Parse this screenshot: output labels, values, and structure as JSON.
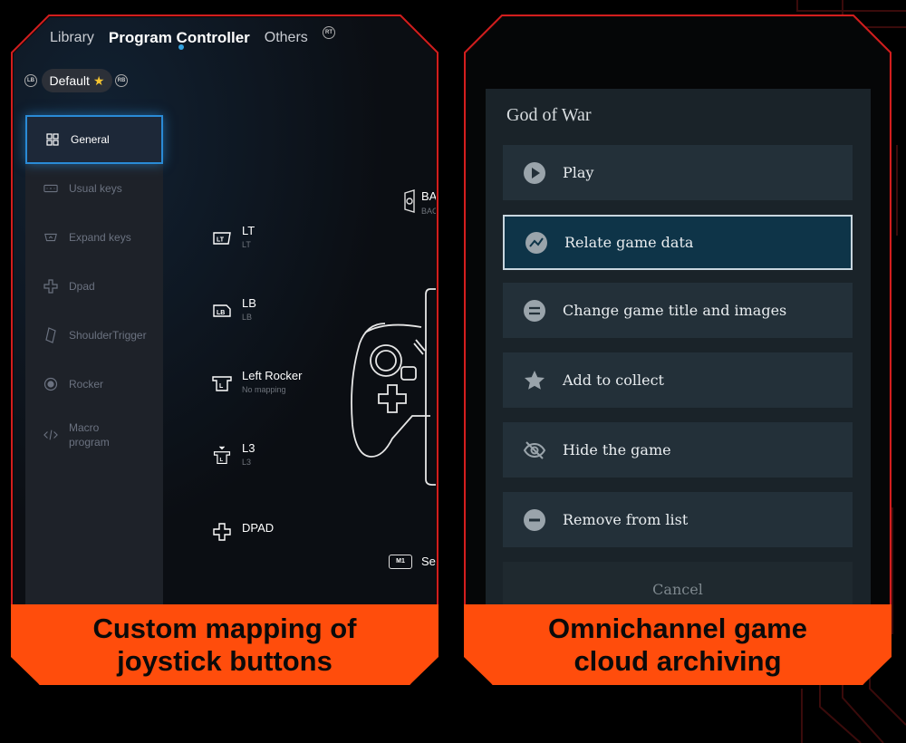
{
  "colors": {
    "accent_orange": "#ff4d0c",
    "frame_red": "#d21e1e",
    "active_blue": "#2a8bd6"
  },
  "left_panel": {
    "tabs": [
      "Library",
      "Program Controller",
      "Others"
    ],
    "rt_hint": "RT",
    "lb_hint": "LB",
    "rb_hint": "RB",
    "profile": "Default",
    "sidebar": [
      {
        "label": "General",
        "icon": "grid-icon",
        "active": true
      },
      {
        "label": "Usual keys",
        "icon": "keyboard-icon"
      },
      {
        "label": "Expand keys",
        "icon": "expand-key-icon"
      },
      {
        "label": "Dpad",
        "icon": "dpad-icon"
      },
      {
        "label": "ShoulderTrigger",
        "icon": "shoulder-trigger-icon"
      },
      {
        "label": "Rocker",
        "icon": "rocker-icon"
      },
      {
        "label": "Macro program",
        "line1": "Macro",
        "line2": "program",
        "icon": "code-icon"
      }
    ],
    "mappings": [
      {
        "title": "LT",
        "sub": "LT",
        "icon": "lt-icon"
      },
      {
        "title": "LB",
        "sub": "LB",
        "icon": "lb-icon"
      },
      {
        "title": "Left Rocker",
        "sub": "No mapping",
        "icon": "left-rocker-icon"
      },
      {
        "title": "L3",
        "sub": "L3",
        "icon": "l3-icon"
      },
      {
        "title": "DPAD",
        "sub": "",
        "icon": "dpad-icon"
      }
    ],
    "right_partial": {
      "top_title": "BA",
      "top_sub": "BAC",
      "bottom_badge": "M1",
      "bottom_title": "Se"
    },
    "caption": "Custom mapping of joystick buttons"
  },
  "right_panel": {
    "game_title": "God of War",
    "menu": [
      {
        "label": "Play",
        "icon": "play-icon"
      },
      {
        "label": "Relate game data",
        "icon": "chart-icon",
        "selected": true
      },
      {
        "label": "Change game title and images",
        "icon": "swap-icon"
      },
      {
        "label": "Add to collect",
        "icon": "star-icon"
      },
      {
        "label": "Hide the game",
        "icon": "eye-off-icon"
      },
      {
        "label": "Remove from list",
        "icon": "minus-circle-icon"
      }
    ],
    "cancel": "Cancel",
    "caption": "Omnichannel game cloud archiving"
  }
}
